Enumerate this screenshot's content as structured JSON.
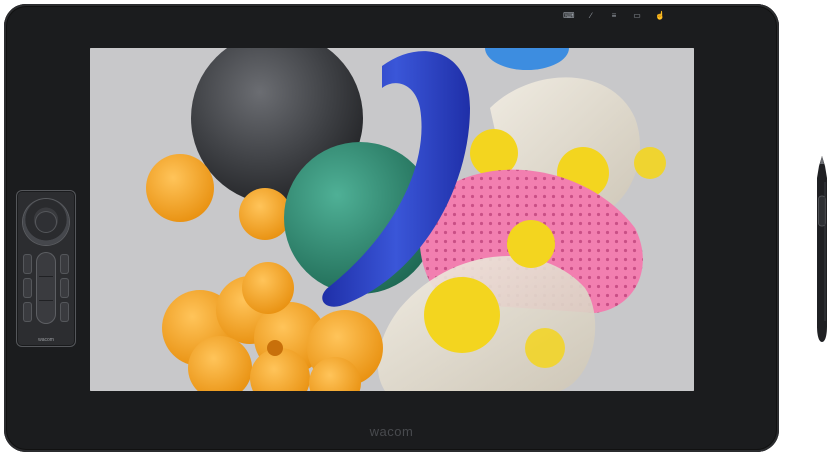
{
  "device": {
    "brand": "wacom",
    "remote_brand": "wacom",
    "top_buttons": [
      "keyboard-icon",
      "pen-settings-icon",
      "menu-icon",
      "display-icon",
      "touch-icon"
    ],
    "colors": {
      "bezel": "#1b1c1e",
      "screen_bg": "#c9c9cb",
      "blue_ring": "#2f48c4",
      "green_sphere": "#2f8a70",
      "pink_tube": "#f27fb0",
      "orange": "#f6a623",
      "yellow": "#f3d51f"
    }
  }
}
